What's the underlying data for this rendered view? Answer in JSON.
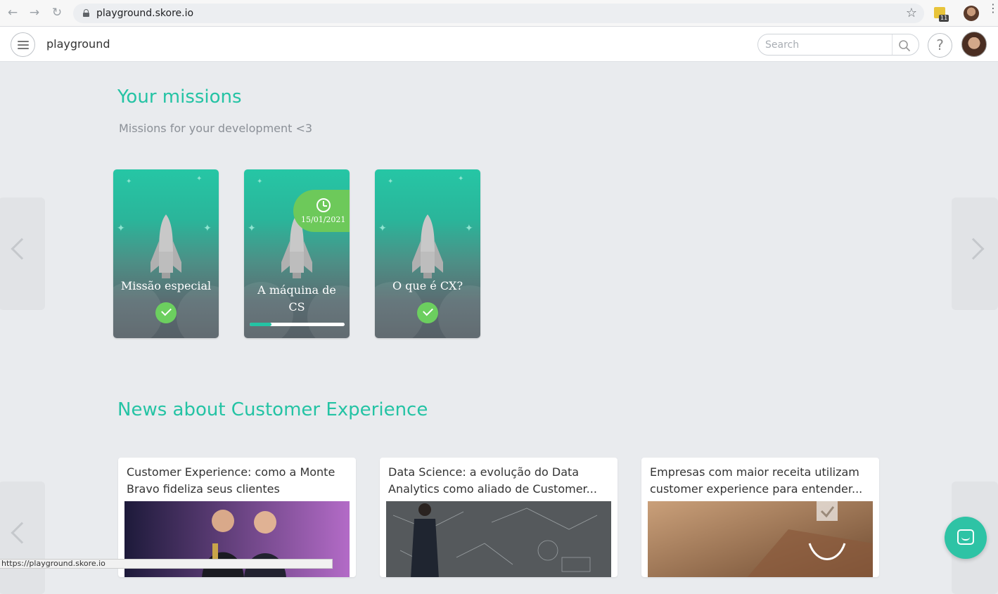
{
  "browser": {
    "url": "playground.skore.io",
    "extension_badge": "11",
    "status_url": "https://playground.skore.io"
  },
  "header": {
    "app_name": "playground",
    "search_placeholder": "Search",
    "help_label": "?"
  },
  "missions": {
    "title": "Your missions",
    "subtitle": "Missions for your development <3",
    "cards": [
      {
        "title": "Missão especial",
        "status": "completed"
      },
      {
        "title": "A máquina de CS",
        "status": "in-progress",
        "due_date": "15/01/2021",
        "progress": 0.23
      },
      {
        "title": "O que é CX?",
        "status": "completed"
      }
    ]
  },
  "news": {
    "title": "News about Customer Experience",
    "articles": [
      {
        "title": "Customer Experience: como a Monte Bravo fideliza seus clientes"
      },
      {
        "title": "Data Science: a evolução do Data Analytics como aliado de Customer..."
      },
      {
        "title": "Empresas com maior receita utilizam customer experience para entender..."
      }
    ]
  },
  "colors": {
    "accent": "#24c3a4",
    "success": "#6ccf5f",
    "background": "#e9ebee"
  }
}
